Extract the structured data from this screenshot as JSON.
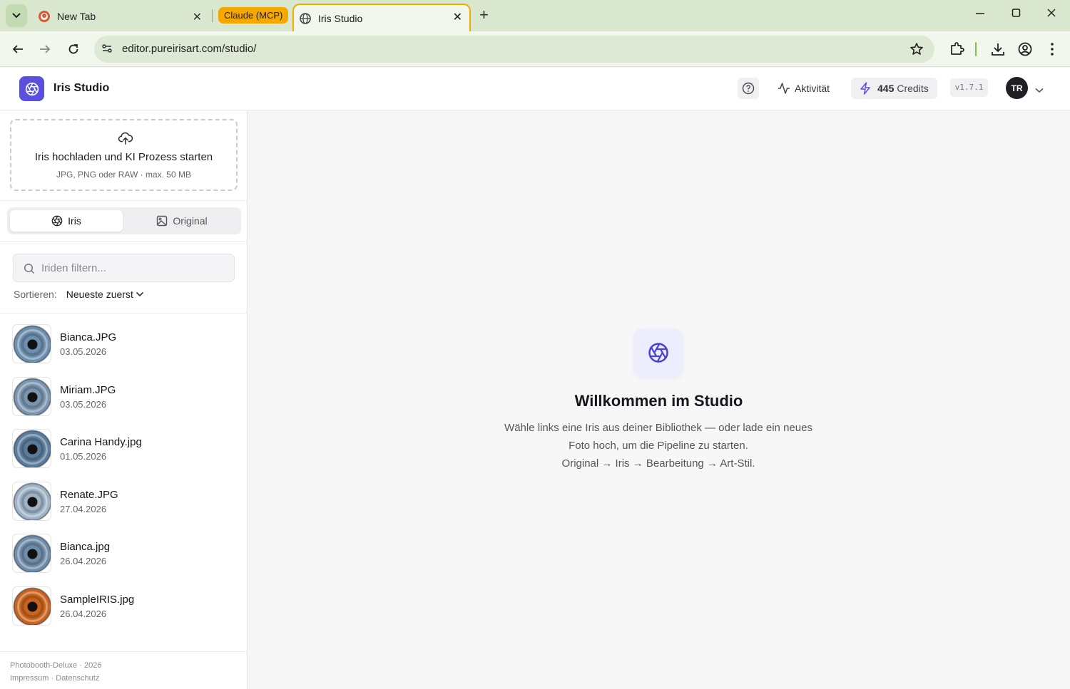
{
  "browser": {
    "tabs": [
      {
        "title": "New Tab"
      },
      {
        "title": "Iris Studio",
        "active": true
      }
    ],
    "tab_group_label": "Claude (MCP)",
    "url": "editor.pureirisart.com/studio/",
    "colors": {
      "tabbar": "#d9e7cf",
      "toolbar": "#f1f7ec",
      "group_accent": "#f5a800"
    }
  },
  "header": {
    "app_title": "Iris Studio",
    "activity_label": "Aktivität",
    "credits_count": "445",
    "credits_label": "Credits",
    "version": "v1.7.1",
    "avatar_initials": "TR",
    "brand_color": "#5b4fe0"
  },
  "sidebar": {
    "upload": {
      "title": "Iris hochladen und KI Prozess starten",
      "subtitle": "JPG, PNG oder RAW · max. 50 MB"
    },
    "view_toggle": {
      "iris_label": "Iris",
      "original_label": "Original",
      "selected": "Iris"
    },
    "search": {
      "placeholder": "Iriden filtern...",
      "value": ""
    },
    "sort": {
      "label": "Sortieren:",
      "selected": "Neueste zuerst"
    },
    "items": [
      {
        "name": "Bianca.JPG",
        "date": "03.05.2026",
        "eye_color": "#6d8fae"
      },
      {
        "name": "Miriam.JPG",
        "date": "03.05.2026",
        "eye_color": "#7a95ae"
      },
      {
        "name": "Carina Handy.jpg",
        "date": "01.05.2026",
        "eye_color": "#5c7c9c"
      },
      {
        "name": "Renate.JPG",
        "date": "27.04.2026",
        "eye_color": "#9fb3c6"
      },
      {
        "name": "Bianca.jpg",
        "date": "26.04.2026",
        "eye_color": "#6f8da9"
      },
      {
        "name": "SampleIRIS.jpg",
        "date": "26.04.2026",
        "eye_color": "#c8641e"
      }
    ],
    "footer": {
      "line1": "Photobooth-Deluxe · 2026",
      "impressum": "Impressum",
      "separator": "·",
      "datenschutz": "Datenschutz"
    }
  },
  "main": {
    "welcome_title": "Willkommen im Studio",
    "welcome_line1": "Wähle links eine Iris aus deiner Bibliothek — oder lade ein neues",
    "welcome_line2": "Foto hoch, um die Pipeline zu starten.",
    "welcome_line3": "Original → Iris → Bearbeitung → Art-Stil."
  }
}
